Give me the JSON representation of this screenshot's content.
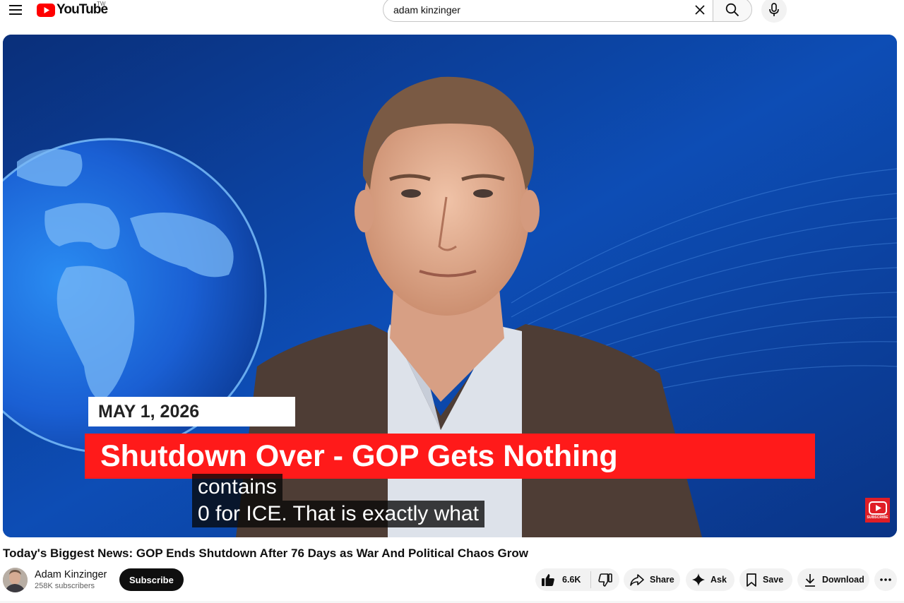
{
  "header": {
    "logo_text": "YouTube",
    "country_code": "TW",
    "search_query": "adam kinzinger",
    "icons": [
      "menu-icon",
      "youtube-play-icon",
      "close-icon",
      "search-icon",
      "microphone-icon"
    ]
  },
  "player": {
    "overlay_date": "MAY 1, 2026",
    "overlay_headline": "Shutdown Over - GOP Gets Nothing",
    "captions": [
      "contains",
      "0 for ICE. That is exactly what"
    ],
    "watermark_label": "SUBSCRIBE",
    "colors": {
      "headline_bar": "#ff1a1a",
      "background": "#0b3c8c"
    }
  },
  "video": {
    "title": "Today's Biggest News: GOP Ends Shutdown After 76 Days as War And Political Chaos Grow"
  },
  "owner": {
    "channel_name": "Adam Kinzinger",
    "subscribers": "258K subscribers",
    "subscribe_label": "Subscribe"
  },
  "actions": {
    "like_count": "6.6K",
    "share_label": "Share",
    "ask_label": "Ask",
    "save_label": "Save",
    "download_label": "Download",
    "icons": [
      "thumb-up-icon",
      "thumb-down-icon",
      "share-icon",
      "sparkle-icon",
      "bookmark-icon",
      "download-icon",
      "more-icon"
    ]
  }
}
